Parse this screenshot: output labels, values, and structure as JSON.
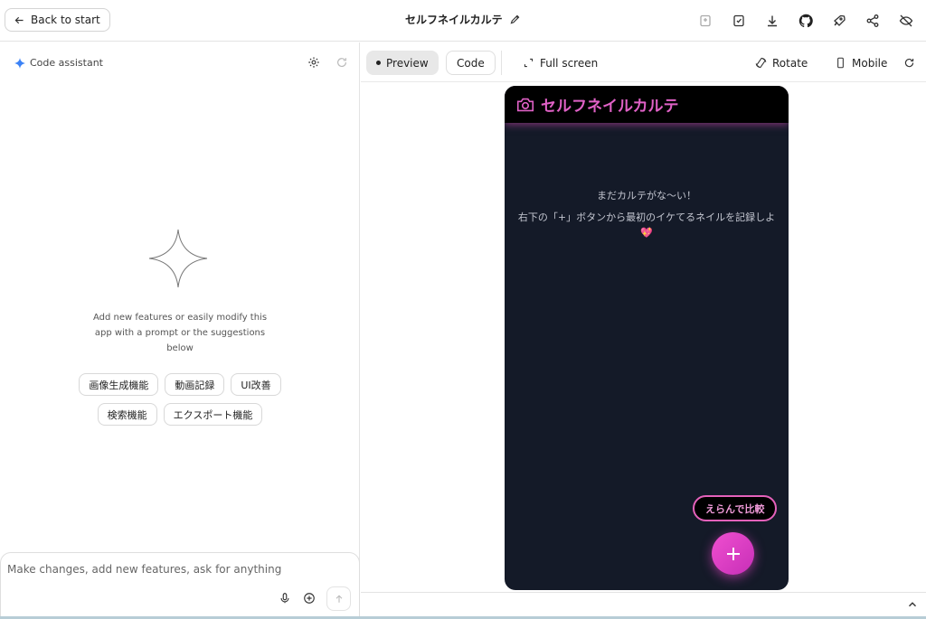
{
  "topbar": {
    "back_label": "Back to start",
    "app_title": "セルフネイルカルテ",
    "icons": [
      "save-draft-icon",
      "save-icon",
      "download-icon",
      "github-icon",
      "deploy-rocket-icon",
      "share-icon",
      "hide-icon"
    ]
  },
  "left_panel": {
    "assistant_label": "Code assistant",
    "hint": "Add new features or easily modify this app with a prompt or the suggestions below",
    "suggestions_row1": [
      "画像生成機能",
      "動画記録",
      "UI改善"
    ],
    "suggestions_row2": [
      "検索機能",
      "エクスポート機能"
    ],
    "prompt_placeholder": "Make changes, add new features, ask for anything"
  },
  "preview_toolbar": {
    "preview_label": "Preview",
    "code_label": "Code",
    "fullscreen_label": "Full screen",
    "rotate_label": "Rotate",
    "mobile_label": "Mobile"
  },
  "phone": {
    "title": "セルフネイルカルテ",
    "empty_line1": "まだカルテがな〜い！",
    "empty_line2": "右下の「+」ボタンから最初のイケてるネイルを記録しよ",
    "heart_emoji": "💖",
    "compare_label": "えらんで比較",
    "accent_color": "#e061c6"
  }
}
